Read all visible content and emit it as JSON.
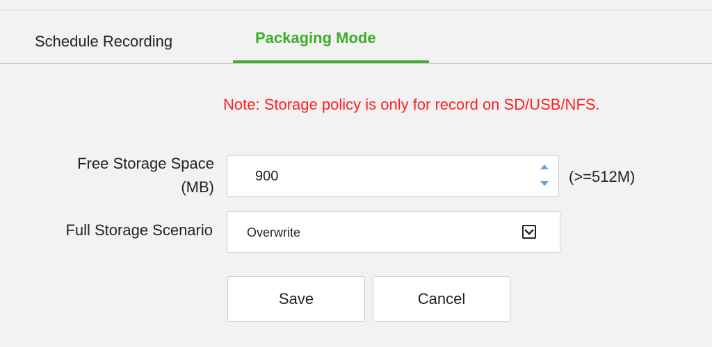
{
  "tabs": [
    {
      "label": "Schedule Recording",
      "active": false
    },
    {
      "label": "Packaging Mode",
      "active": true
    }
  ],
  "colors": {
    "accent": "#3cae29",
    "note": "#ff1f1f",
    "spinner": "#6aa1d6"
  },
  "note": "Note: Storage policy is only for record on SD/USB/NFS.",
  "free_storage": {
    "label_line1": "Free Storage Space",
    "label_line2": "(MB)",
    "value": "900",
    "hint": "(>=512M)"
  },
  "full_storage": {
    "label": "Full Storage Scenario",
    "selected": "Overwrite"
  },
  "buttons": {
    "save": "Save",
    "cancel": "Cancel"
  },
  "icons": {
    "spinner_up": "triangle-up",
    "spinner_down": "triangle-down",
    "select_arrow": "chevron-down"
  }
}
